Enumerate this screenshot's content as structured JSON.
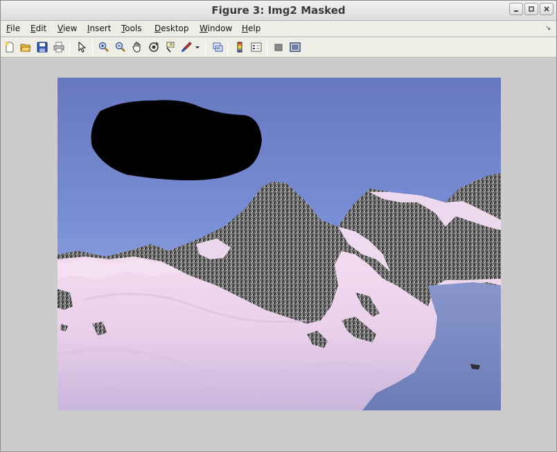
{
  "window": {
    "title": "Figure 3: Img2 Masked",
    "controls": [
      "minimize-icon",
      "maximize-icon",
      "close-icon"
    ]
  },
  "menubar": {
    "items": [
      {
        "label": "File",
        "mnemonic": "F"
      },
      {
        "label": "Edit",
        "mnemonic": "E"
      },
      {
        "label": "View",
        "mnemonic": "V"
      },
      {
        "label": "Insert",
        "mnemonic": "I"
      },
      {
        "label": "Tools",
        "mnemonic": "T"
      },
      {
        "label": "Desktop",
        "mnemonic": "D"
      },
      {
        "label": "Window",
        "mnemonic": "W"
      },
      {
        "label": "Help",
        "mnemonic": "H"
      }
    ]
  },
  "toolbar": {
    "icons": [
      "new-figure-icon",
      "open-file-icon",
      "save-icon",
      "print-icon",
      "pointer-icon",
      "zoom-in-icon",
      "zoom-out-icon",
      "pan-icon",
      "rotate-3d-icon",
      "data-cursor-icon",
      "brush-icon",
      "brush-dropdown-icon",
      "link-plot-icon",
      "colorbar-icon",
      "legend-icon",
      "hide-plot-tools-icon",
      "show-plot-tools-icon"
    ]
  },
  "figure": {
    "image": "masked-mountain-image",
    "mask_color": "#000000",
    "sky_color": "#6f84cc",
    "snow_color": "#efd6ec",
    "rock_color": "#5e5e5e"
  }
}
